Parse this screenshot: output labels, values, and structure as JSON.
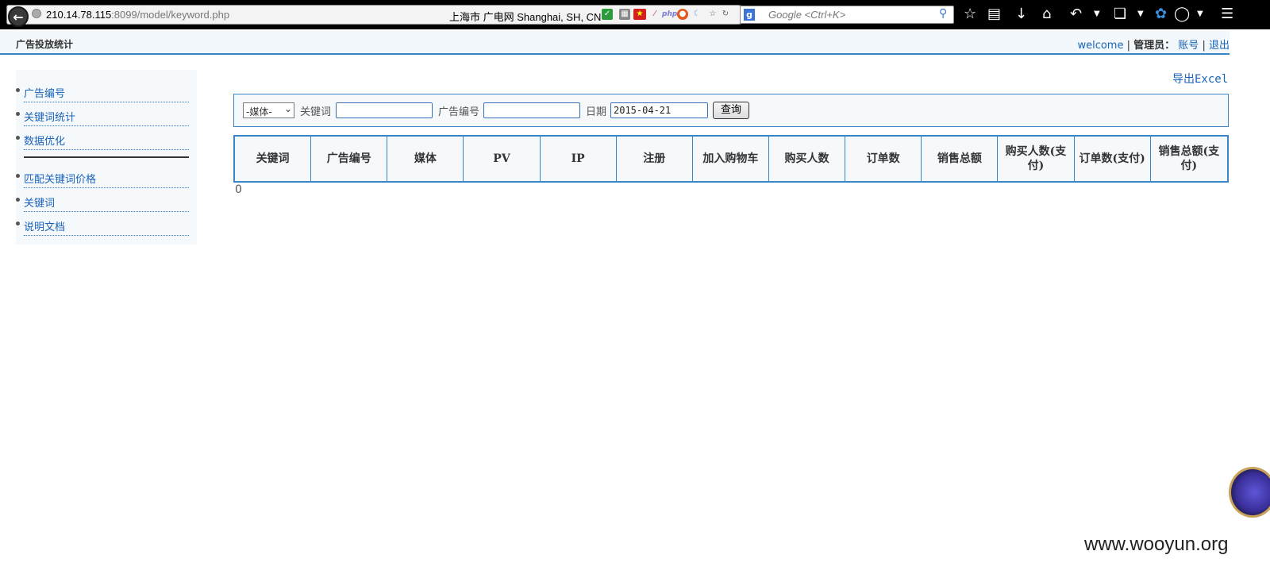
{
  "browser": {
    "url_host": "210.14.78.115",
    "url_path": ":8099/model/keyword.php",
    "geo_info": "上海市 广电网   Shanghai, SH, CN",
    "search_placeholder": "Google <Ctrl+K>",
    "addon_php": "php"
  },
  "header": {
    "title": "广告投放统计",
    "welcome": "welcome",
    "separator": "|",
    "role_label": "管理员：",
    "account_link": "账号",
    "logout_link": "退出"
  },
  "sidebar": {
    "group1": [
      "广告编号",
      "关键词统计",
      "数据优化"
    ],
    "group2": [
      "匹配关键词价格",
      "关键词",
      "说明文档"
    ]
  },
  "main": {
    "export_label": "导出Excel",
    "filter": {
      "media_select_value": "-媒体-",
      "keyword_label": "关键词",
      "keyword_value": "",
      "ad_id_label": "广告编号",
      "ad_id_value": "",
      "date_label": "日期",
      "date_value": "2015-04-21",
      "query_button": "查询"
    },
    "table_headers": [
      "关键词",
      "广告编号",
      "媒体",
      "PV",
      "IP",
      "注册",
      "加入购物车",
      "购买人数",
      "订单数",
      "销售总额",
      "购买人数(支付)",
      "订单数(支付)",
      "销售总额(支付)"
    ],
    "result_count": "0"
  },
  "watermark": "www.wooyun.org"
}
